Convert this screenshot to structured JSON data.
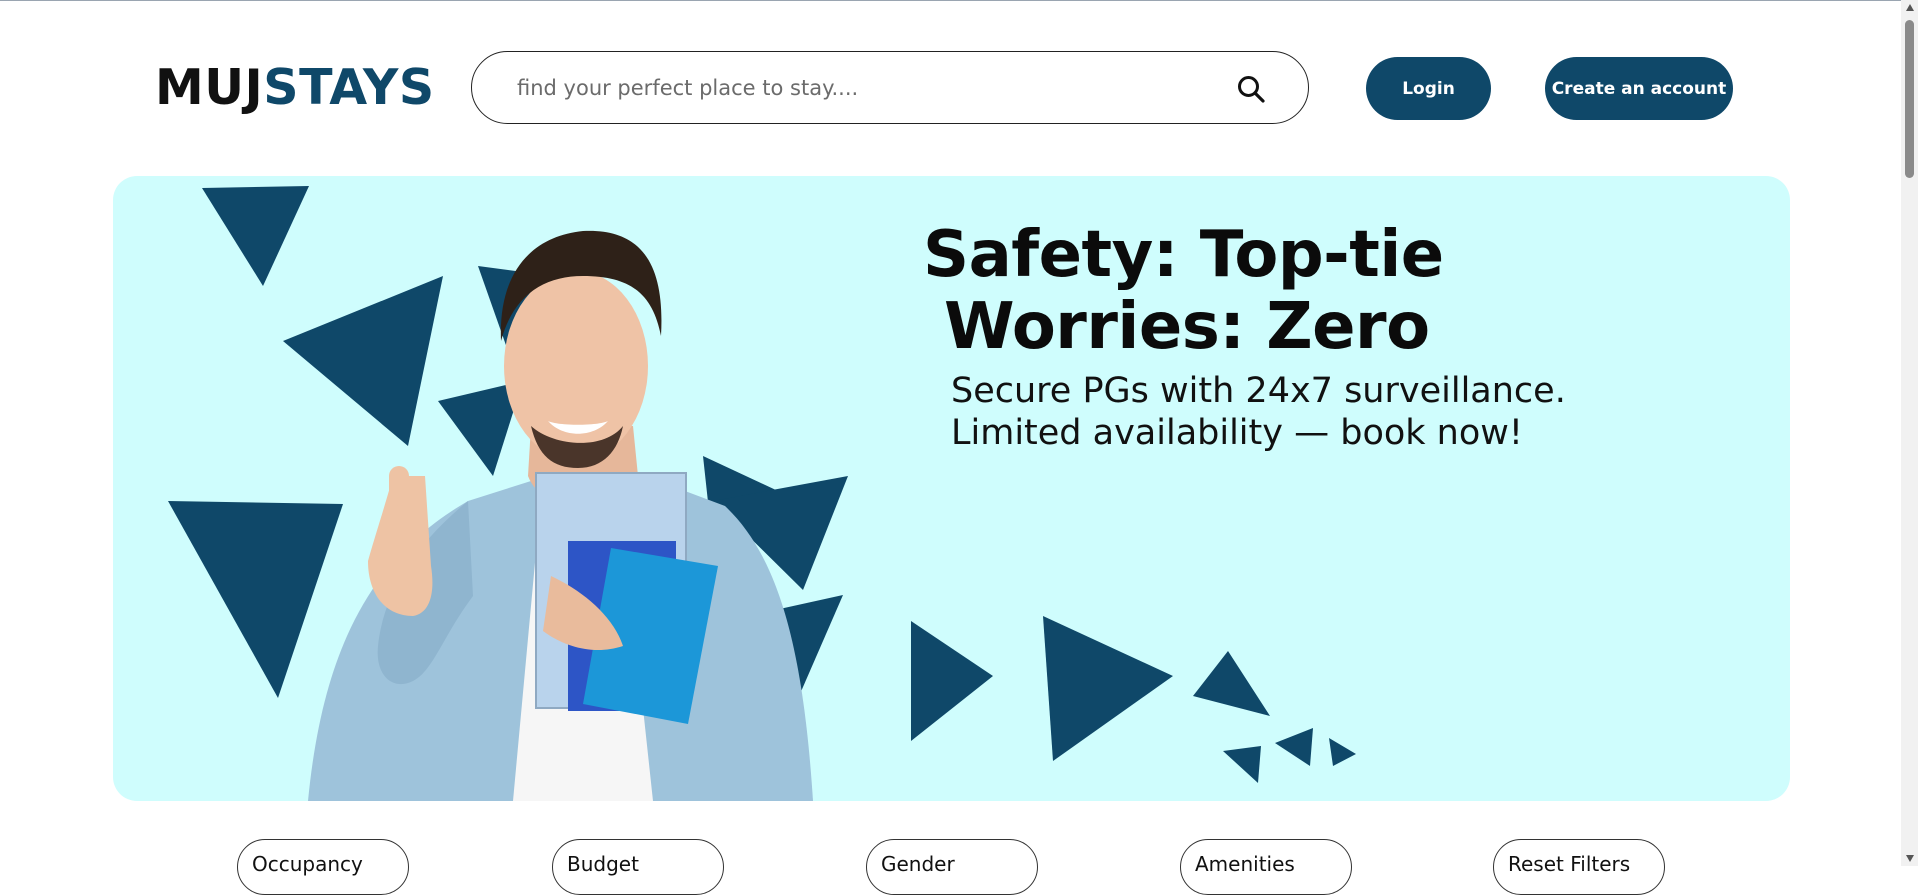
{
  "header": {
    "logo": {
      "part1": "MUJ",
      "part2": "STAYS"
    },
    "search": {
      "placeholder": "find your perfect place to stay....",
      "icon": "search-icon"
    },
    "login_label": "Login",
    "create_account_label": "Create an account"
  },
  "banner": {
    "headline_line1": "Safety: Top-tie",
    "headline_line2": "Worries: Zero",
    "subline_line1": "Secure PGs with 24x7 surveillance.",
    "subline_line2": "Limited availability — book now!",
    "background_color": "#cffdfd",
    "shape_color": "#0f4869"
  },
  "filters": [
    {
      "label": "Occupancy"
    },
    {
      "label": "Budget"
    },
    {
      "label": "Gender"
    },
    {
      "label": "Amenities"
    },
    {
      "label": "Reset Filters"
    }
  ],
  "colors": {
    "brand": "#0f4869"
  }
}
